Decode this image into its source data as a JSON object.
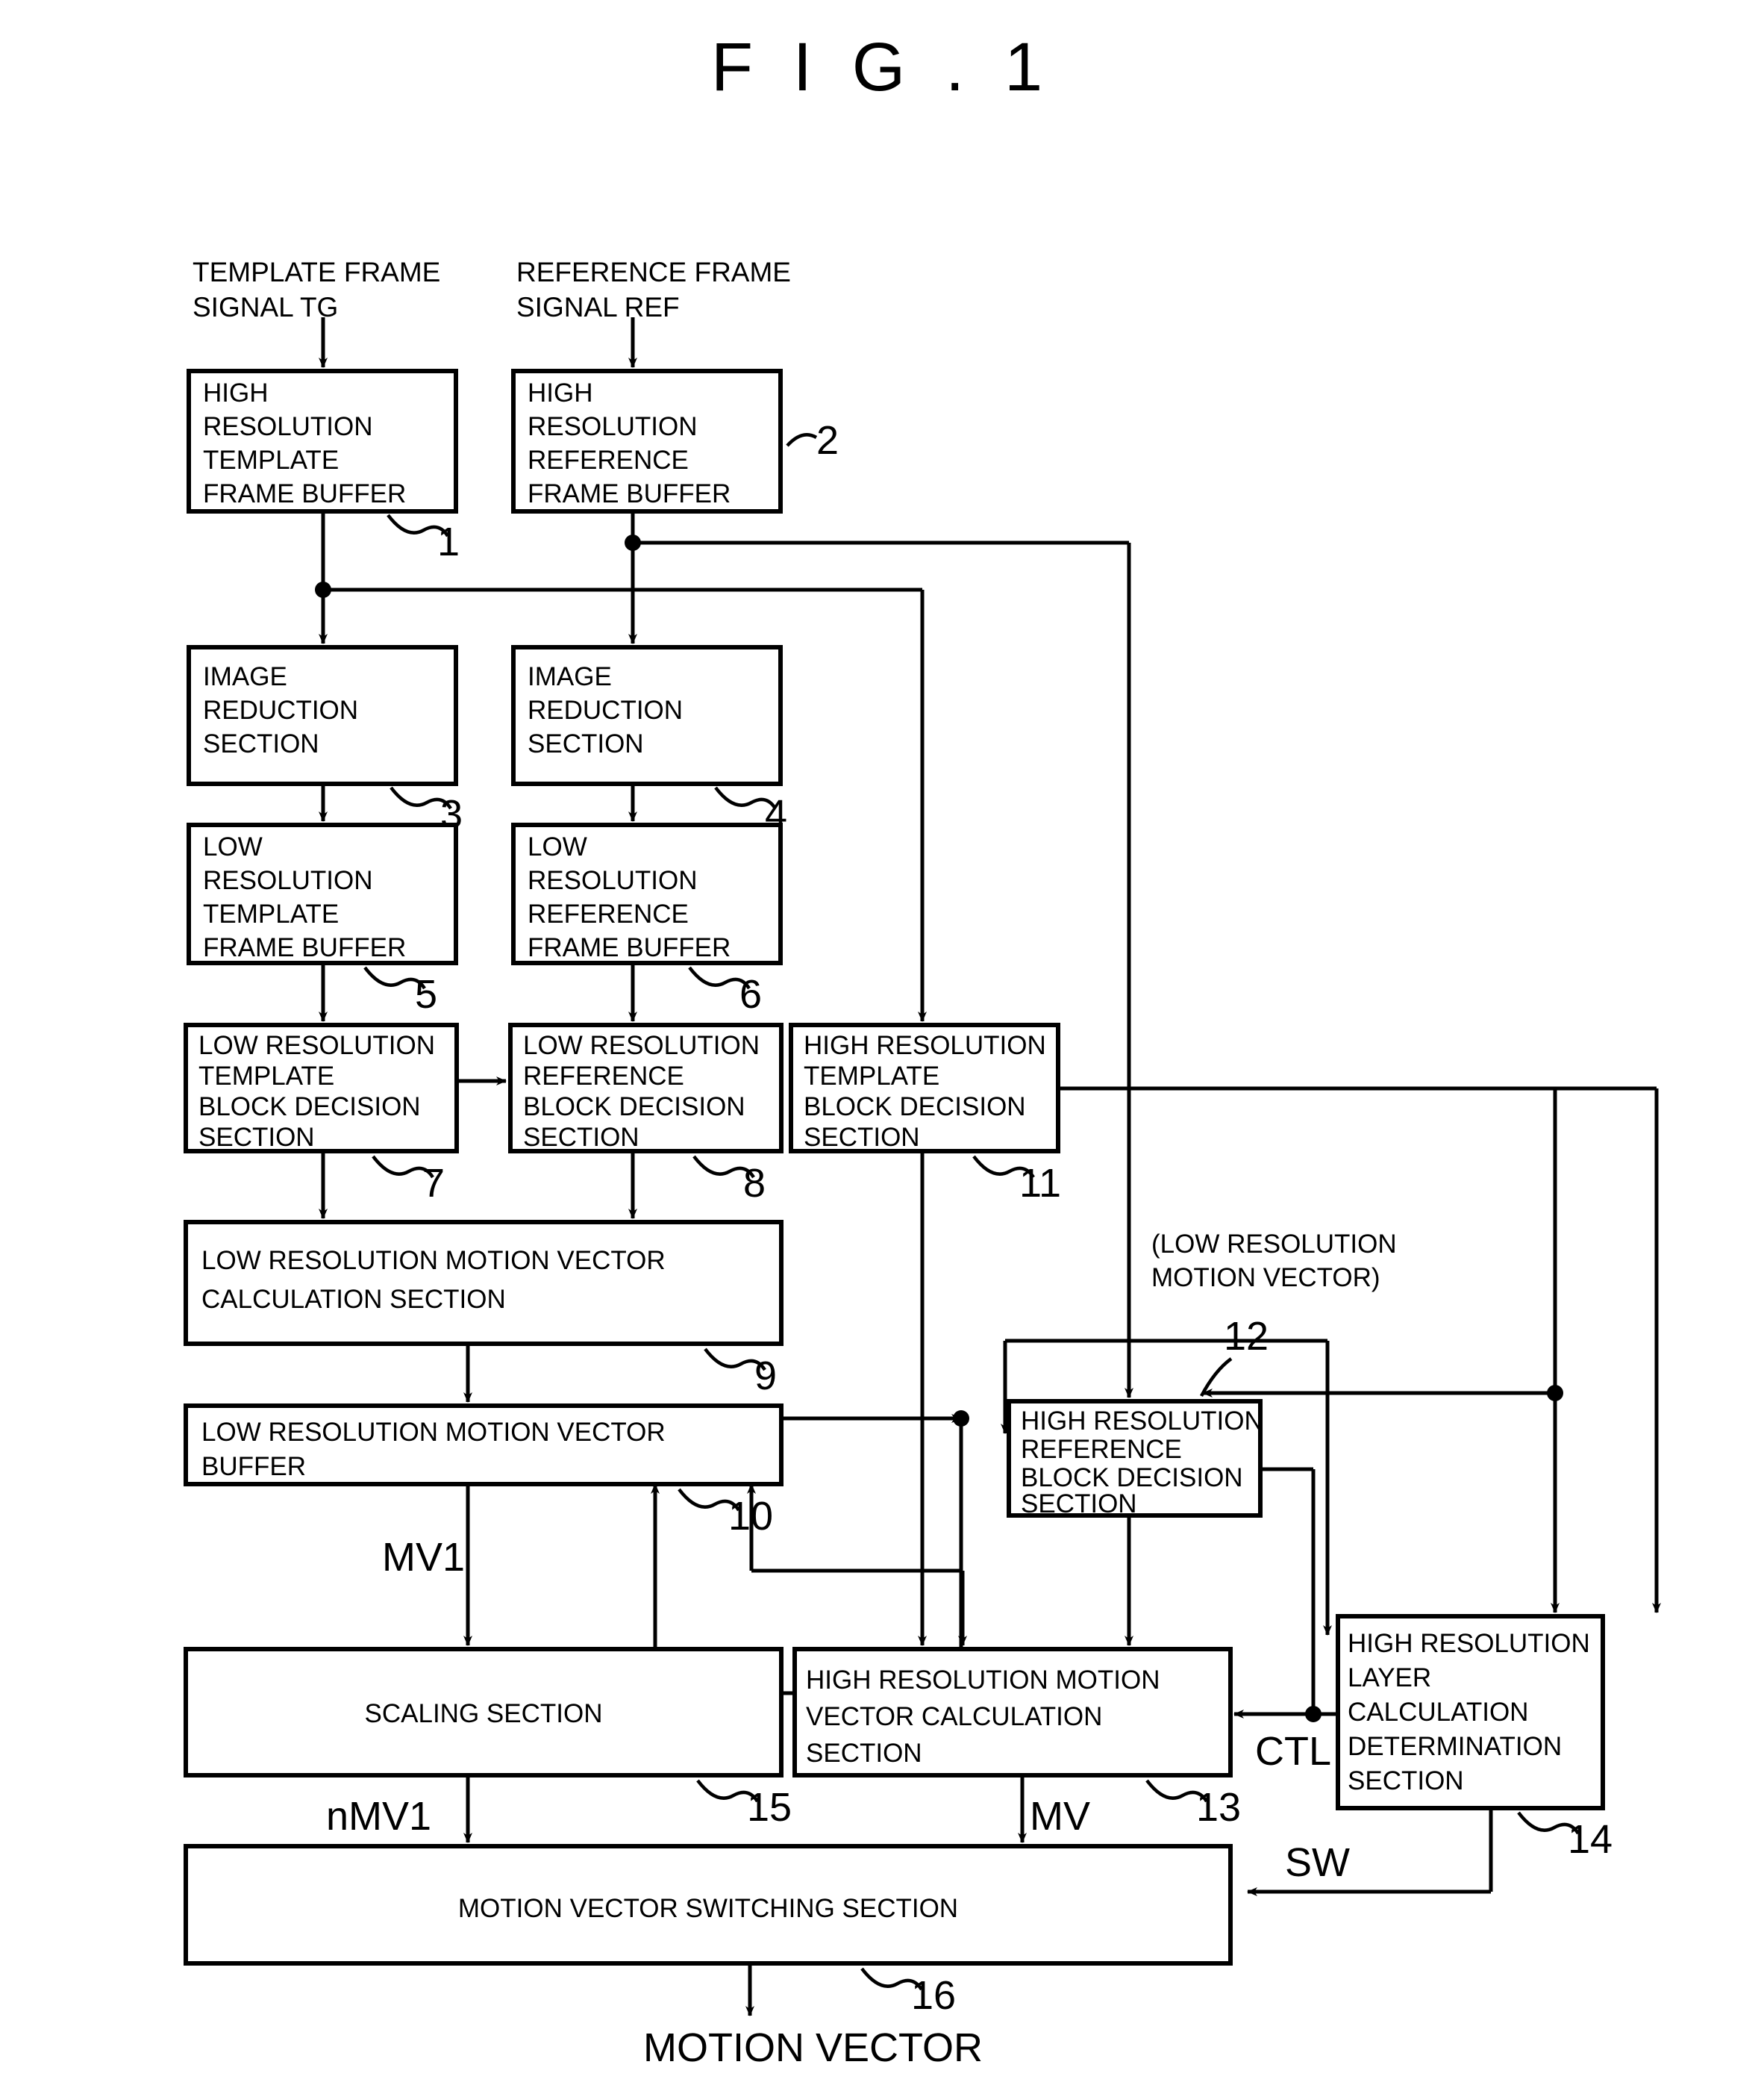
{
  "figure": {
    "title": "F I G . 1"
  },
  "inputs": [
    {
      "id": "tg",
      "line1": "TEMPLATE FRAME",
      "line2": "SIGNAL TG"
    },
    {
      "id": "ref",
      "line1": "REFERENCE FRAME",
      "line2": "SIGNAL REF"
    }
  ],
  "output": {
    "label": "MOTION VECTOR"
  },
  "blocks": [
    {
      "ref": "1",
      "lines": [
        "HIGH",
        "RESOLUTION",
        "TEMPLATE",
        "FRAME BUFFER"
      ]
    },
    {
      "ref": "2",
      "lines": [
        "HIGH",
        "RESOLUTION",
        "REFERENCE",
        "FRAME BUFFER"
      ]
    },
    {
      "ref": "3",
      "lines": [
        "IMAGE",
        "REDUCTION",
        "SECTION"
      ]
    },
    {
      "ref": "4",
      "lines": [
        "IMAGE",
        "REDUCTION",
        "SECTION"
      ]
    },
    {
      "ref": "5",
      "lines": [
        "LOW",
        "RESOLUTION",
        "TEMPLATE",
        "FRAME BUFFER"
      ]
    },
    {
      "ref": "6",
      "lines": [
        "LOW",
        "RESOLUTION",
        "REFERENCE",
        "FRAME BUFFER"
      ]
    },
    {
      "ref": "7",
      "lines": [
        "LOW RESOLUTION",
        "TEMPLATE",
        "BLOCK DECISION",
        "SECTION"
      ]
    },
    {
      "ref": "8",
      "lines": [
        "LOW RESOLUTION",
        "REFERENCE",
        "BLOCK DECISION",
        "SECTION"
      ]
    },
    {
      "ref": "11",
      "lines": [
        "HIGH RESOLUTION",
        "TEMPLATE",
        "BLOCK DECISION",
        "SECTION"
      ]
    },
    {
      "ref": "9",
      "lines": [
        "LOW RESOLUTION MOTION VECTOR",
        "CALCULATION SECTION"
      ]
    },
    {
      "ref": "10",
      "lines": [
        "LOW RESOLUTION MOTION VECTOR",
        "BUFFER"
      ]
    },
    {
      "ref": "12",
      "lines": [
        "HIGH RESOLUTION",
        "REFERENCE",
        "BLOCK DECISION",
        "SECTION"
      ]
    },
    {
      "ref": "15",
      "lines": [
        "SCALING SECTION"
      ]
    },
    {
      "ref": "13",
      "lines": [
        "HIGH RESOLUTION MOTION",
        "VECTOR CALCULATION",
        "SECTION"
      ]
    },
    {
      "ref": "14",
      "lines": [
        "HIGH RESOLUTION",
        "LAYER",
        "CALCULATION",
        "DETERMINATION",
        "SECTION"
      ]
    },
    {
      "ref": "16",
      "lines": [
        "MOTION VECTOR SWITCHING SECTION"
      ]
    }
  ],
  "annotations": [
    {
      "id": "lowres-mv-note-l1",
      "text": "(LOW RESOLUTION"
    },
    {
      "id": "lowres-mv-note-l2",
      "text": "MOTION VECTOR)"
    }
  ],
  "signals": [
    {
      "id": "mv1",
      "text": "MV1"
    },
    {
      "id": "nmv1",
      "text": "nMV1"
    },
    {
      "id": "mv",
      "text": "MV"
    },
    {
      "id": "ctl",
      "text": "CTL"
    },
    {
      "id": "sw",
      "text": "SW"
    }
  ],
  "colors": {
    "ink": "#000000",
    "paper": "#ffffff"
  }
}
